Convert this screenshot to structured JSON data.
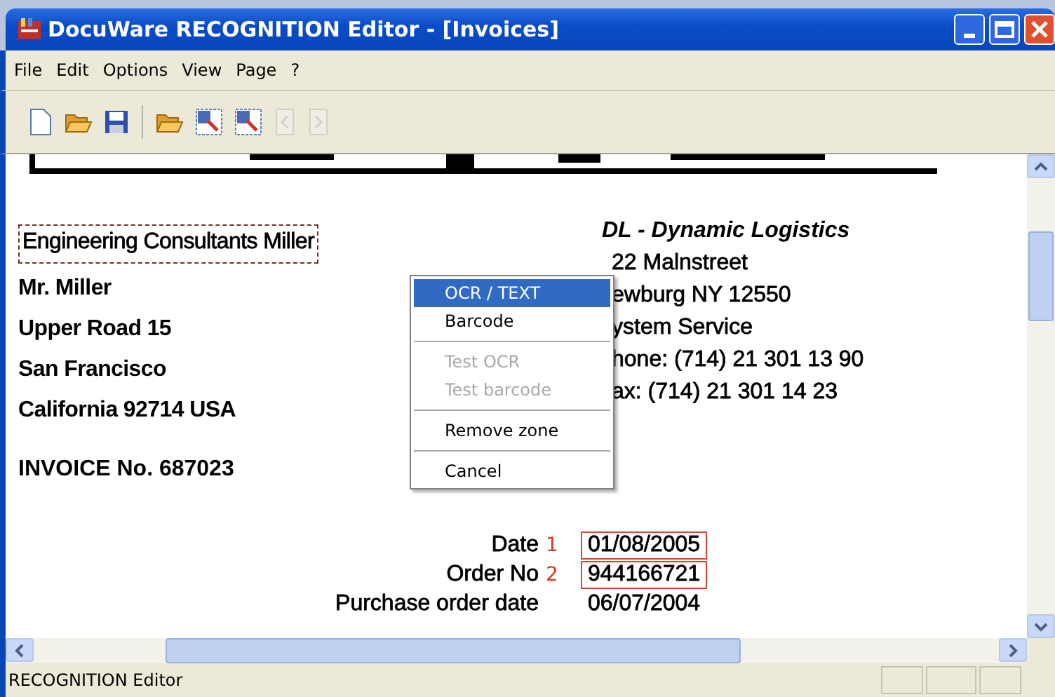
{
  "window": {
    "title": "DocuWare RECOGNITION Editor - [Invoices]"
  },
  "menu": [
    "File",
    "Edit",
    "Options",
    "View",
    "Page",
    "?"
  ],
  "toolbar": [
    {
      "kind": "new",
      "disabled": false
    },
    {
      "kind": "open",
      "disabled": false
    },
    {
      "kind": "save",
      "disabled": false
    },
    {
      "kind": "sep"
    },
    {
      "kind": "folder",
      "disabled": false
    },
    {
      "kind": "zone",
      "disabled": false
    },
    {
      "kind": "zone2",
      "disabled": false
    },
    {
      "kind": "prev",
      "disabled": true
    },
    {
      "kind": "next",
      "disabled": true
    }
  ],
  "document": {
    "sender": [
      {
        "text": "Engineering Consultants Miller",
        "selected": true
      },
      {
        "text": "Mr. Miller",
        "selected": false
      },
      {
        "text": "Upper Road 15",
        "selected": false
      },
      {
        "text": "San Francisco",
        "selected": false
      },
      {
        "text": "California 92714 USA",
        "selected": false
      }
    ],
    "invoice_no": "INVOICE No. 687023",
    "company": {
      "name": "DL - Dynamic Logistics",
      "lines": [
        "22 Malnstreet",
        "ewburg NY 12550",
        "ystem Service",
        "hone: (714) 21 301 13 90",
        "ax: (714) 21 301 14 23"
      ]
    },
    "fields": [
      {
        "label": "Date",
        "marker": "1",
        "value": "01/08/2005",
        "zoned": true
      },
      {
        "label": "Order No",
        "marker": "2",
        "value": "944166721",
        "zoned": true
      },
      {
        "label": "Purchase order date",
        "value": "06/07/2004",
        "zoned": false
      }
    ]
  },
  "context_menu": [
    {
      "kind": "item",
      "label": "OCR / TEXT",
      "selected": true,
      "disabled": false
    },
    {
      "kind": "item",
      "label": "Barcode",
      "selected": false,
      "disabled": false
    },
    {
      "kind": "separator"
    },
    {
      "kind": "item",
      "label": "Test OCR",
      "selected": false,
      "disabled": true
    },
    {
      "kind": "item",
      "label": "Test barcode",
      "selected": false,
      "disabled": true
    },
    {
      "kind": "separator"
    },
    {
      "kind": "item",
      "label": "Remove zone",
      "selected": false,
      "disabled": false
    },
    {
      "kind": "separator"
    },
    {
      "kind": "item",
      "label": "Cancel",
      "selected": false,
      "disabled": false
    }
  ],
  "status_bar": {
    "text": "RECOGNITION Editor"
  }
}
